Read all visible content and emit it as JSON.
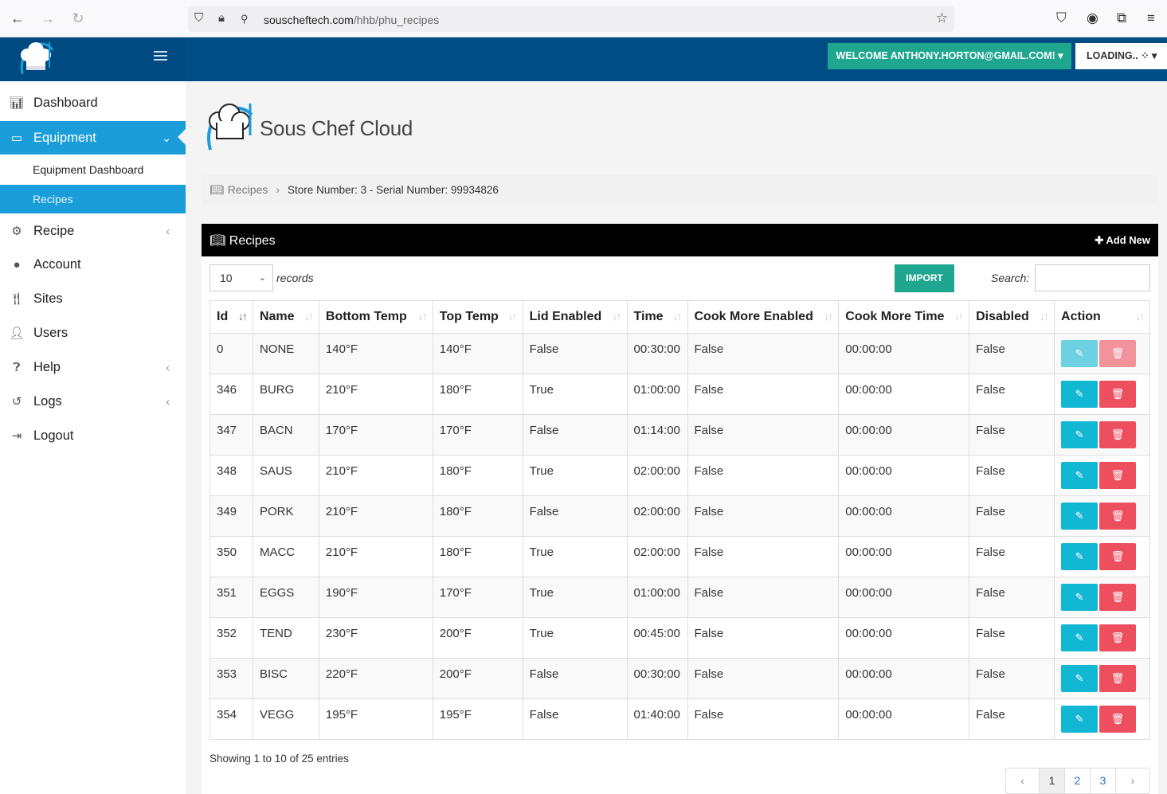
{
  "browser": {
    "url_host": "souscheftech.com",
    "url_path": "/hhb/phu_recipes"
  },
  "header": {
    "welcome": "WELCOME ANTHONY.HORTON@GMAIL.COM!",
    "loading": "LOADING.."
  },
  "sidebar": {
    "items": [
      {
        "label": "Dashboard"
      },
      {
        "label": "Equipment"
      },
      {
        "label": "Equipment Dashboard"
      },
      {
        "label": "Recipes"
      },
      {
        "label": "Recipe"
      },
      {
        "label": "Account"
      },
      {
        "label": "Sites"
      },
      {
        "label": "Users"
      },
      {
        "label": "Help"
      },
      {
        "label": "Logs"
      },
      {
        "label": "Logout"
      }
    ]
  },
  "brand": {
    "title": "Sous Chef Cloud"
  },
  "breadcrumb": {
    "root": "Recipes",
    "current": "Store Number: 3 - Serial Number: 99934826"
  },
  "panel": {
    "title": "Recipes",
    "add_new": "Add New",
    "length_value": "10",
    "records_label": "records",
    "import_label": "IMPORT",
    "search_label": "Search:",
    "search_value": ""
  },
  "table": {
    "headers": [
      "Id",
      "Name",
      "Bottom Temp",
      "Top Temp",
      "Lid Enabled",
      "Time",
      "Cook More Enabled",
      "Cook More Time",
      "Disabled",
      "Action"
    ],
    "rows": [
      [
        "0",
        "NONE",
        "140°F",
        "140°F",
        "False",
        "00:30:00",
        "False",
        "00:00:00",
        "False"
      ],
      [
        "346",
        "BURG",
        "210°F",
        "180°F",
        "True",
        "01:00:00",
        "False",
        "00:00:00",
        "False"
      ],
      [
        "347",
        "BACN",
        "170°F",
        "170°F",
        "False",
        "01:14:00",
        "False",
        "00:00:00",
        "False"
      ],
      [
        "348",
        "SAUS",
        "210°F",
        "180°F",
        "True",
        "02:00:00",
        "False",
        "00:00:00",
        "False"
      ],
      [
        "349",
        "PORK",
        "210°F",
        "180°F",
        "False",
        "02:00:00",
        "False",
        "00:00:00",
        "False"
      ],
      [
        "350",
        "MACC",
        "210°F",
        "180°F",
        "True",
        "02:00:00",
        "False",
        "00:00:00",
        "False"
      ],
      [
        "351",
        "EGGS",
        "190°F",
        "170°F",
        "True",
        "01:00:00",
        "False",
        "00:00:00",
        "False"
      ],
      [
        "352",
        "TEND",
        "230°F",
        "200°F",
        "True",
        "00:45:00",
        "False",
        "00:00:00",
        "False"
      ],
      [
        "353",
        "BISC",
        "220°F",
        "200°F",
        "False",
        "00:30:00",
        "False",
        "00:00:00",
        "False"
      ],
      [
        "354",
        "VEGG",
        "195°F",
        "195°F",
        "False",
        "01:40:00",
        "False",
        "00:00:00",
        "False"
      ]
    ]
  },
  "footer": {
    "showing": "Showing 1 to 10 of 25 entries",
    "pages": [
      "‹",
      "1",
      "2",
      "3",
      "›"
    ]
  },
  "colors": {
    "header_bg": "#004d86",
    "active_nav": "#1a9dd9",
    "teal_button": "#1ea68f",
    "edit_button": "#12b7d4",
    "delete_button": "#ee4f5e"
  }
}
